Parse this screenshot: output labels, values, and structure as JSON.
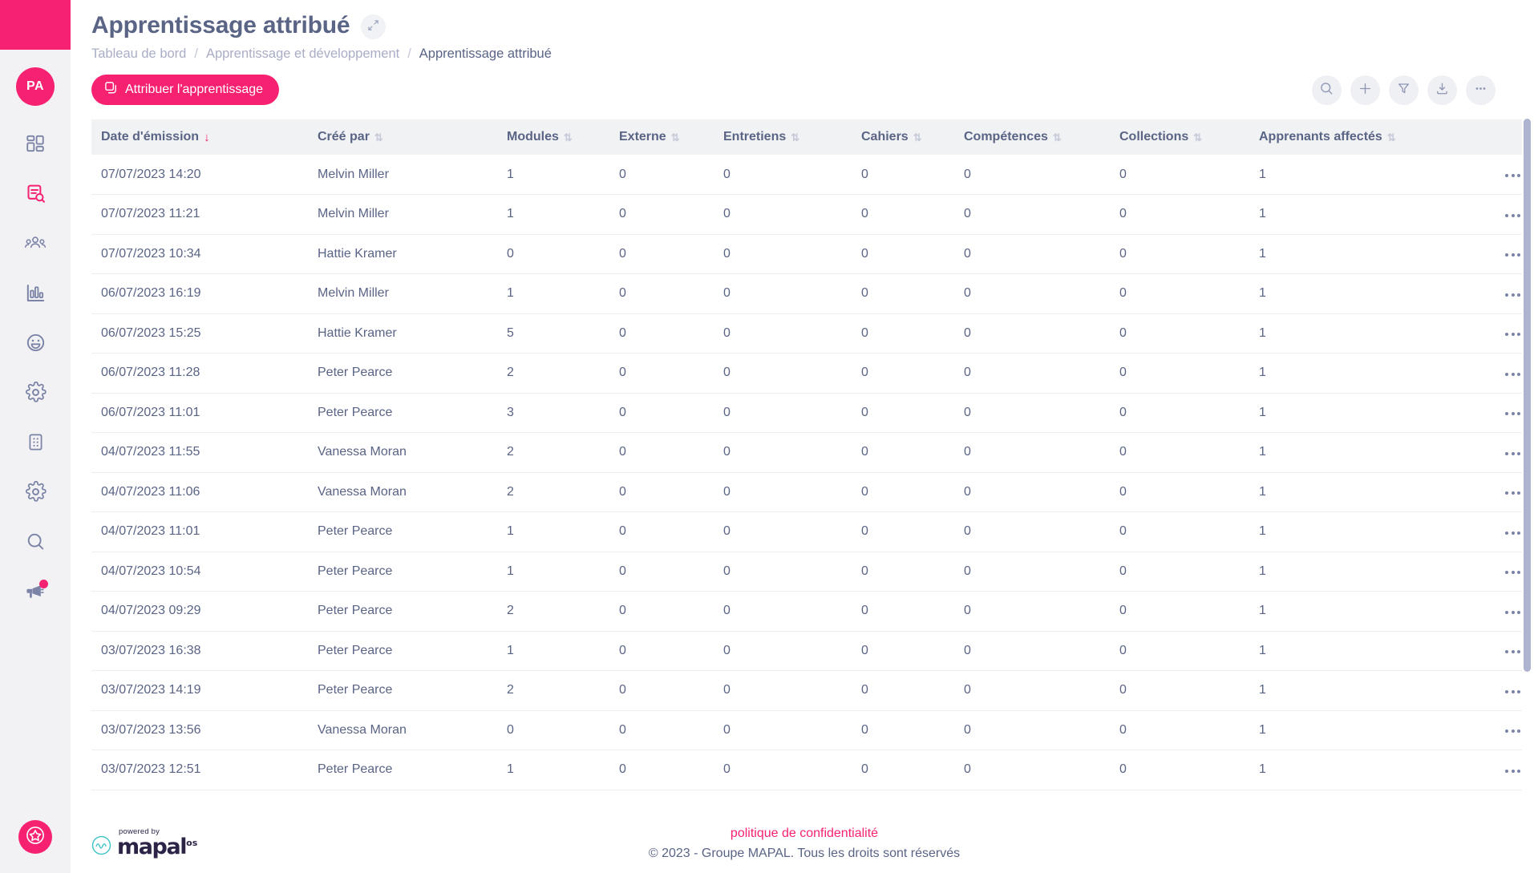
{
  "colors": {
    "accent_pink": "#F72172",
    "text_slate": "#5A6485",
    "muted_slate": "#A9AEC6",
    "sidebar_bg": "#F2F2F4",
    "header_row_bg": "#F1F2F4",
    "scrollbar": "#AEB4D0"
  },
  "sidebar": {
    "avatar_initials": "PA",
    "items": [
      {
        "name": "dashboard",
        "icon": "dashboard-grid-icon",
        "active": false
      },
      {
        "name": "learning",
        "icon": "document-search-icon",
        "active": true
      },
      {
        "name": "people",
        "icon": "people-group-icon",
        "active": false
      },
      {
        "name": "reports",
        "icon": "bar-chart-icon",
        "active": false
      },
      {
        "name": "engagement",
        "icon": "smiley-face-icon",
        "active": false
      },
      {
        "name": "settings",
        "icon": "gear-icon",
        "active": false
      },
      {
        "name": "locations",
        "icon": "building-icon",
        "active": false
      },
      {
        "name": "admin",
        "icon": "gear-icon",
        "active": false
      },
      {
        "name": "search",
        "icon": "magnifier-icon",
        "active": false
      },
      {
        "name": "announcements",
        "icon": "megaphone-icon",
        "active": false,
        "badge": true
      }
    ],
    "bottom_button_icon": "star-circle-icon"
  },
  "header": {
    "title": "Apprentissage attribué",
    "expand_icon": "expand-arrows-icon",
    "breadcrumb": [
      {
        "label": "Tableau de bord",
        "current": false
      },
      {
        "label": "Apprentissage et développement",
        "current": false
      },
      {
        "label": "Apprentissage attribué",
        "current": true
      }
    ],
    "separator": "/"
  },
  "actions": {
    "primary_button_label": "Attribuer l'apprentissage",
    "primary_button_icon": "copy-icon",
    "toolbar": [
      {
        "name": "search-icon",
        "glyph": "search"
      },
      {
        "name": "plus-icon",
        "glyph": "plus"
      },
      {
        "name": "filter-icon",
        "glyph": "funnel"
      },
      {
        "name": "download-icon",
        "glyph": "download"
      },
      {
        "name": "more-icon",
        "glyph": "ellipsis"
      }
    ]
  },
  "table": {
    "columns": [
      {
        "label": "Date d'émission",
        "sorted": true,
        "direction": "desc"
      },
      {
        "label": "Créé par",
        "sorted": false
      },
      {
        "label": "Modules",
        "sorted": false
      },
      {
        "label": "Externe",
        "sorted": false
      },
      {
        "label": "Entretiens",
        "sorted": false
      },
      {
        "label": "Cahiers",
        "sorted": false
      },
      {
        "label": "Compétences",
        "sorted": false
      },
      {
        "label": "Collections",
        "sorted": false
      },
      {
        "label": "Apprenants affectés",
        "sorted": false
      }
    ],
    "sort_desc_glyph": "↓",
    "sort_none_glyph": "⇅",
    "row_action_icon": "kebab-menu-icon",
    "rows": [
      {
        "date": "07/07/2023 14:20",
        "author": "Melvin Miller",
        "modules": "1",
        "externe": "0",
        "entretiens": "0",
        "cahiers": "0",
        "competences": "0",
        "collections": "0",
        "apprenants": "1"
      },
      {
        "date": "07/07/2023 11:21",
        "author": "Melvin Miller",
        "modules": "1",
        "externe": "0",
        "entretiens": "0",
        "cahiers": "0",
        "competences": "0",
        "collections": "0",
        "apprenants": "1"
      },
      {
        "date": "07/07/2023 10:34",
        "author": "Hattie Kramer",
        "modules": "0",
        "externe": "0",
        "entretiens": "0",
        "cahiers": "0",
        "competences": "0",
        "collections": "0",
        "apprenants": "1"
      },
      {
        "date": "06/07/2023 16:19",
        "author": "Melvin Miller",
        "modules": "1",
        "externe": "0",
        "entretiens": "0",
        "cahiers": "0",
        "competences": "0",
        "collections": "0",
        "apprenants": "1"
      },
      {
        "date": "06/07/2023 15:25",
        "author": "Hattie Kramer",
        "modules": "5",
        "externe": "0",
        "entretiens": "0",
        "cahiers": "0",
        "competences": "0",
        "collections": "0",
        "apprenants": "1"
      },
      {
        "date": "06/07/2023 11:28",
        "author": "Peter Pearce",
        "modules": "2",
        "externe": "0",
        "entretiens": "0",
        "cahiers": "0",
        "competences": "0",
        "collections": "0",
        "apprenants": "1"
      },
      {
        "date": "06/07/2023 11:01",
        "author": "Peter Pearce",
        "modules": "3",
        "externe": "0",
        "entretiens": "0",
        "cahiers": "0",
        "competences": "0",
        "collections": "0",
        "apprenants": "1"
      },
      {
        "date": "04/07/2023 11:55",
        "author": "Vanessa Moran",
        "modules": "2",
        "externe": "0",
        "entretiens": "0",
        "cahiers": "0",
        "competences": "0",
        "collections": "0",
        "apprenants": "1"
      },
      {
        "date": "04/07/2023 11:06",
        "author": "Vanessa Moran",
        "modules": "2",
        "externe": "0",
        "entretiens": "0",
        "cahiers": "0",
        "competences": "0",
        "collections": "0",
        "apprenants": "1"
      },
      {
        "date": "04/07/2023 11:01",
        "author": "Peter Pearce",
        "modules": "1",
        "externe": "0",
        "entretiens": "0",
        "cahiers": "0",
        "competences": "0",
        "collections": "0",
        "apprenants": "1"
      },
      {
        "date": "04/07/2023 10:54",
        "author": "Peter Pearce",
        "modules": "1",
        "externe": "0",
        "entretiens": "0",
        "cahiers": "0",
        "competences": "0",
        "collections": "0",
        "apprenants": "1"
      },
      {
        "date": "04/07/2023 09:29",
        "author": "Peter Pearce",
        "modules": "2",
        "externe": "0",
        "entretiens": "0",
        "cahiers": "0",
        "competences": "0",
        "collections": "0",
        "apprenants": "1"
      },
      {
        "date": "03/07/2023 16:38",
        "author": "Peter Pearce",
        "modules": "1",
        "externe": "0",
        "entretiens": "0",
        "cahiers": "0",
        "competences": "0",
        "collections": "0",
        "apprenants": "1"
      },
      {
        "date": "03/07/2023 14:19",
        "author": "Peter Pearce",
        "modules": "2",
        "externe": "0",
        "entretiens": "0",
        "cahiers": "0",
        "competences": "0",
        "collections": "0",
        "apprenants": "1"
      },
      {
        "date": "03/07/2023 13:56",
        "author": "Vanessa Moran",
        "modules": "0",
        "externe": "0",
        "entretiens": "0",
        "cahiers": "0",
        "competences": "0",
        "collections": "0",
        "apprenants": "1"
      },
      {
        "date": "03/07/2023 12:51",
        "author": "Peter Pearce",
        "modules": "1",
        "externe": "0",
        "entretiens": "0",
        "cahiers": "0",
        "competences": "0",
        "collections": "0",
        "apprenants": "1"
      }
    ]
  },
  "footer": {
    "powered_by": "powered by",
    "brand_word": "mapal",
    "brand_suffix": "os",
    "privacy_link": "politique de confidentialité",
    "copyright": "© 2023 - Groupe MAPAL. Tous les droits sont réservés"
  }
}
